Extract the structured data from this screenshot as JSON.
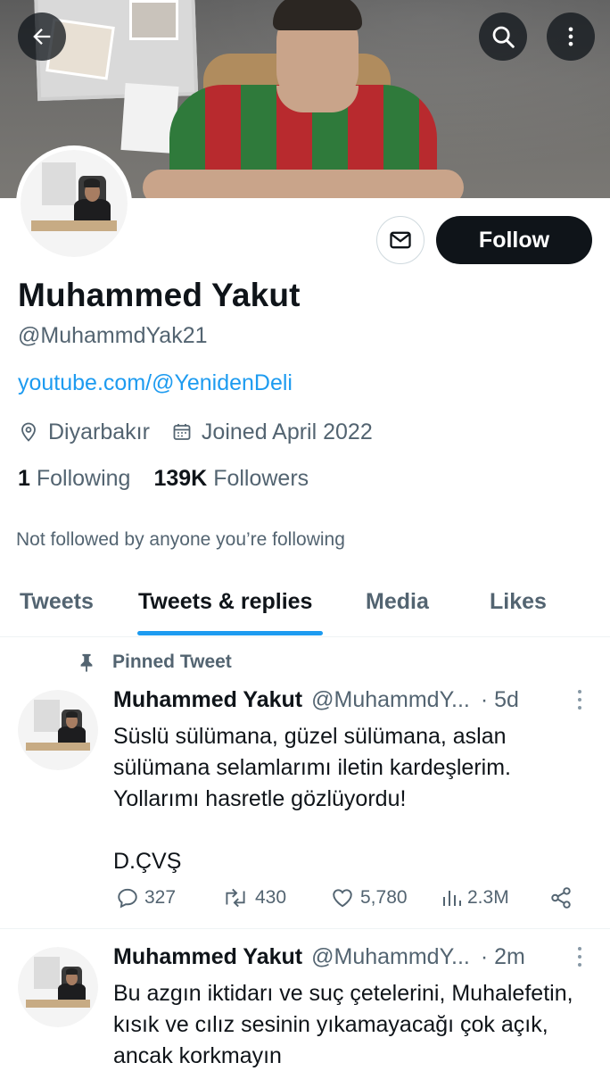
{
  "header": {
    "back_icon": "arrow-left-icon",
    "search_icon": "search-icon",
    "more_icon": "more-vertical-icon"
  },
  "profile": {
    "name": "Muhammed Yakut",
    "handle": "@MuhammdYak21",
    "link": "youtube.com/@YenidenDeli",
    "location": "Diyarbakır",
    "joined": "Joined April 2022",
    "following_count": "1",
    "following_label": "Following",
    "followers_count": "139K",
    "followers_label": "Followers",
    "not_followed_text": "Not followed by anyone you’re following",
    "follow_label": "Follow"
  },
  "tabs": [
    {
      "label": "Tweets"
    },
    {
      "label": "Tweets & replies"
    },
    {
      "label": "Media"
    },
    {
      "label": "Likes"
    }
  ],
  "active_tab": "Tweets & replies",
  "pinned_label": "Pinned Tweet",
  "tweets": [
    {
      "name": "Muhammed Yakut",
      "handle": "@MuhammdY...",
      "time": "· 5d",
      "text": "Süslü sülümana, güzel sülümana, aslan sülümana selamlarımı iletin kardeşlerim. Yollarımı hasretle gözlüyordu!\n\nD.ÇVŞ",
      "replies": "327",
      "retweets": "430",
      "likes": "5,780",
      "views": "2.3M"
    },
    {
      "name": "Muhammed Yakut",
      "handle": "@MuhammdY...",
      "time": "· 2m",
      "text": "Bu azgın iktidarı ve suç çetelerini, Muhalefetin, kısık ve cılız sesinin yıkamayacağı çok açık, ancak korkmayın"
    }
  ],
  "colors": {
    "accent": "#1d9bf0",
    "text_primary": "#0f1419",
    "text_secondary": "#536471",
    "follow_button": "#0f1419"
  }
}
